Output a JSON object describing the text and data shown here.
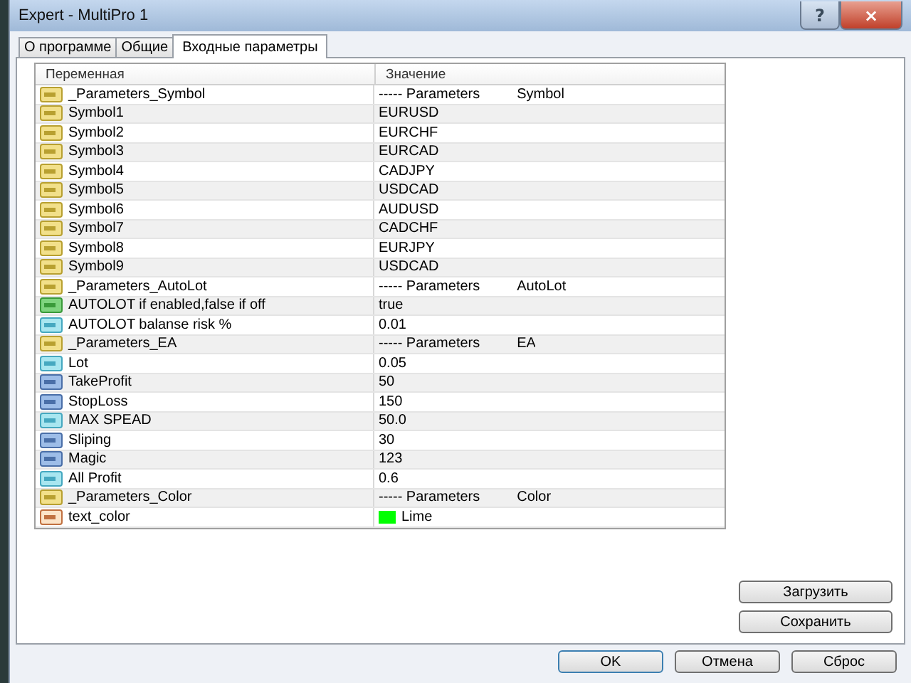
{
  "window": {
    "title": "Expert - MultiPro 1",
    "help": "?",
    "close": "×"
  },
  "tabs": [
    {
      "label": "О программе",
      "selected": false
    },
    {
      "label": "Общие",
      "selected": false
    },
    {
      "label": "Входные параметры",
      "selected": true
    }
  ],
  "table": {
    "columns": [
      "Переменная",
      "Значение"
    ],
    "rows": [
      {
        "kind": "string",
        "name": "_Parameters_Symbol",
        "value": "----- Parameters",
        "value_2": "Symbol"
      },
      {
        "kind": "string",
        "name": "Symbol1",
        "value": "EURUSD"
      },
      {
        "kind": "string",
        "name": "Symbol2",
        "value": "EURCHF"
      },
      {
        "kind": "string",
        "name": "Symbol3",
        "value": "EURCAD"
      },
      {
        "kind": "string",
        "name": "Symbol4",
        "value": "CADJPY"
      },
      {
        "kind": "string",
        "name": "Symbol5",
        "value": "USDCAD"
      },
      {
        "kind": "string",
        "name": "Symbol6",
        "value": "AUDUSD"
      },
      {
        "kind": "string",
        "name": "Symbol7",
        "value": "CADCHF"
      },
      {
        "kind": "string",
        "name": "Symbol8",
        "value": "EURJPY"
      },
      {
        "kind": "string",
        "name": "Symbol9",
        "value": "USDCAD"
      },
      {
        "kind": "string",
        "name": "_Parameters_AutoLot",
        "value": "----- Parameters",
        "value_2": "AutoLot"
      },
      {
        "kind": "bool",
        "name": "AUTOLOT if enabled,false if off",
        "value": "true"
      },
      {
        "kind": "double",
        "name": "AUTOLOT balanse risk %",
        "value": "0.01"
      },
      {
        "kind": "string",
        "name": "_Parameters_EA",
        "value": "----- Parameters",
        "value_2": "EA"
      },
      {
        "kind": "double",
        "name": "Lot",
        "value": "0.05"
      },
      {
        "kind": "int",
        "name": "TakeProfit",
        "value": "50"
      },
      {
        "kind": "int",
        "name": "StopLoss",
        "value": "150"
      },
      {
        "kind": "double",
        "name": "MAX SPEAD",
        "value": "50.0"
      },
      {
        "kind": "int",
        "name": "Sliping",
        "value": "30"
      },
      {
        "kind": "int",
        "name": "Magic",
        "value": "123"
      },
      {
        "kind": "double",
        "name": "All Profit",
        "value": "0.6"
      },
      {
        "kind": "string",
        "name": "_Parameters_Color",
        "value": "----- Parameters",
        "value_2": "Color"
      },
      {
        "kind": "color",
        "name": "text_color",
        "value": "Lime",
        "color": "#00ff00"
      }
    ]
  },
  "side_buttons": [
    "Загрузить",
    "Сохранить"
  ],
  "buttons": [
    "OK",
    "Отмена",
    "Сброс"
  ]
}
